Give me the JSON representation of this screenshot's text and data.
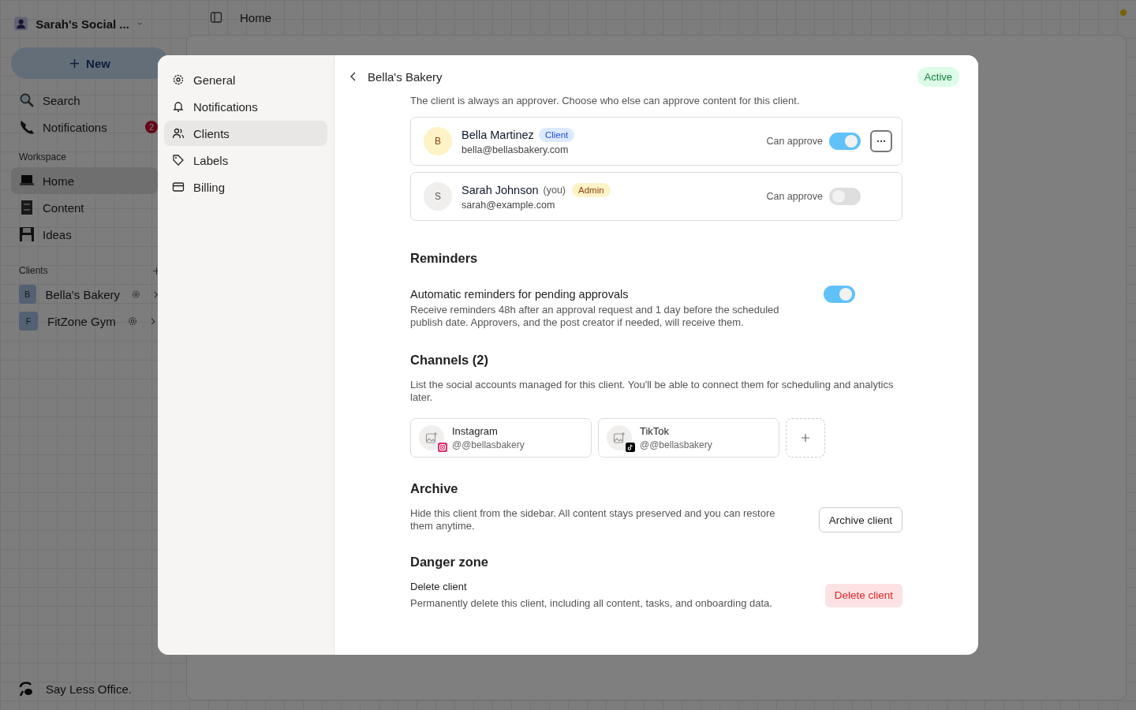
{
  "workspace": {
    "name": "Sarah's Social ..."
  },
  "new_button": {
    "label": "New"
  },
  "quick_nav": [
    {
      "kind": "search",
      "label": "Search"
    },
    {
      "kind": "notifications",
      "label": "Notifications",
      "badge": "2"
    }
  ],
  "workspace_section": {
    "heading": "Workspace",
    "items": [
      {
        "kind": "home",
        "label": "Home",
        "selected": true
      },
      {
        "kind": "content",
        "label": "Content",
        "selected": false
      },
      {
        "kind": "ideas",
        "label": "Ideas",
        "selected": false
      }
    ]
  },
  "clients_section": {
    "heading": "Clients",
    "items": [
      {
        "initial": "B",
        "label": "Bella's Bakery"
      },
      {
        "initial": "F",
        "label": "FitZone Gym"
      }
    ]
  },
  "footer": {
    "brand": "Say Less Office."
  },
  "topbar": {
    "breadcrumb": "Home"
  },
  "settings": {
    "nav": [
      {
        "kind": "general",
        "label": "General",
        "selected": false
      },
      {
        "kind": "notifications",
        "label": "Notifications",
        "selected": false
      },
      {
        "kind": "clients",
        "label": "Clients",
        "selected": true
      },
      {
        "kind": "labels",
        "label": "Labels",
        "selected": false
      },
      {
        "kind": "billing",
        "label": "Billing",
        "selected": false
      }
    ],
    "header": {
      "title": "Bella's Bakery",
      "status": "Active"
    },
    "approvers": {
      "description": "The client is always an approver. Choose who else can approve content for this client.",
      "people": [
        {
          "initial": "B",
          "name": "Bella Martinez",
          "role": "Client",
          "kind": "client",
          "email": "bella@bellasbakery.com",
          "toggle_label": "Can approve",
          "on": true,
          "has_menu": true
        },
        {
          "initial": "S",
          "name": "Sarah Johnson",
          "you": "(you)",
          "role": "Admin",
          "kind": "admin",
          "email": "sarah@example.com",
          "toggle_label": "Can approve",
          "on": false,
          "has_menu": false
        }
      ]
    },
    "reminders": {
      "heading": "Reminders",
      "title": "Automatic reminders for pending approvals",
      "description": "Receive reminders 48h after an approval request and 1 day before the scheduled publish date. Approvers, and the post creator if needed, will receive them.",
      "on": true
    },
    "channels": {
      "heading": "Channels (2)",
      "description": "List the social accounts managed for this client. You'll be able to connect them for scheduling and analytics later.",
      "accounts": [
        {
          "kind": "instagram",
          "name": "Instagram",
          "handle": "@@bellasbakery"
        },
        {
          "kind": "tiktok",
          "name": "TikTok",
          "handle": "@@bellasbakery"
        }
      ]
    },
    "archive": {
      "heading": "Archive",
      "description": "Hide this client from the sidebar. All content stays preserved and you can restore them anytime.",
      "button": "Archive client"
    },
    "danger": {
      "heading": "Danger zone",
      "title": "Delete client",
      "description": "Permanently delete this client, including all content, tasks, and onboarding data.",
      "button": "Delete client"
    }
  }
}
